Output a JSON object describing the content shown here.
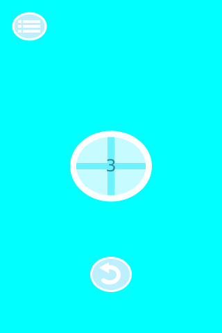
{
  "screen": {
    "background_color": "#00ffff"
  },
  "menu_button": {
    "icon": "list-menu-icon",
    "color": "#bfefff"
  },
  "center_target": {
    "count": "3",
    "icon": "crosshair-icon",
    "fill_color": "#c6fcff",
    "ring_color": "#ffffff",
    "cross_color": "#6df2ff"
  },
  "restart_button": {
    "icon": "restart-arrow-icon",
    "color": "#bcefff"
  }
}
